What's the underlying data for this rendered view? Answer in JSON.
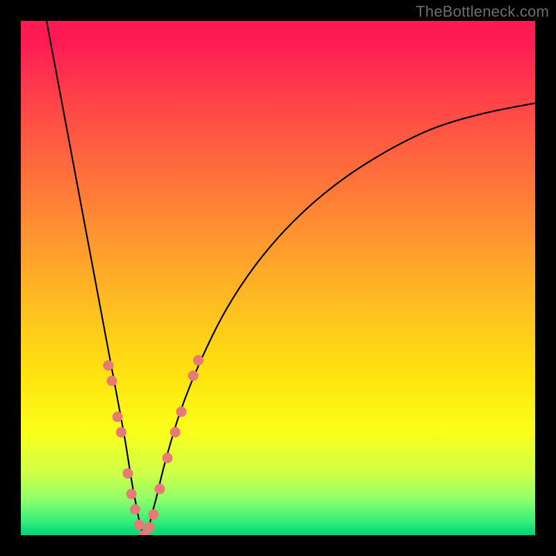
{
  "watermark": {
    "text": "TheBottleneck.com"
  },
  "chart_data": {
    "type": "line",
    "title": "",
    "xlabel": "",
    "ylabel": "",
    "xlim": [
      0,
      100
    ],
    "ylim": [
      0,
      100
    ],
    "background_gradient_note": "vertical spectral gradient: red (top) → orange → yellow → green (bottom)",
    "series": [
      {
        "name": "bottleneck-curve",
        "note": "Black V-shaped curve; minimum near x≈24, y≈0. Left branch steep, right branch convex asymptotic.",
        "x": [
          5,
          8,
          11,
          14,
          17,
          20,
          22,
          24,
          26,
          28,
          31,
          35,
          40,
          46,
          53,
          61,
          70,
          80,
          90,
          100
        ],
        "y": [
          100,
          84,
          68,
          52,
          36,
          20,
          8,
          0,
          6,
          14,
          24,
          34,
          44,
          53,
          61,
          68,
          74,
          79,
          82,
          84
        ]
      },
      {
        "name": "marker-dots-left-branch",
        "note": "Salmon-colored dot markers clustered along the lower part of the left branch.",
        "x": [
          17.0,
          17.7,
          18.8,
          19.5,
          20.8,
          21.5,
          22.2,
          23.0,
          24.0
        ],
        "y": [
          33.0,
          30.0,
          23.0,
          20.0,
          12.0,
          8.0,
          5.0,
          2.0,
          0.0
        ]
      },
      {
        "name": "marker-dots-right-branch",
        "note": "Salmon-colored dot markers clustered along the lower part of the right branch.",
        "x": [
          25.0,
          25.8,
          27.0,
          28.5,
          30.0,
          31.2,
          33.5,
          34.5
        ],
        "y": [
          1.5,
          4.0,
          9.0,
          15.0,
          20.0,
          24.0,
          31.0,
          34.0
        ]
      }
    ]
  }
}
